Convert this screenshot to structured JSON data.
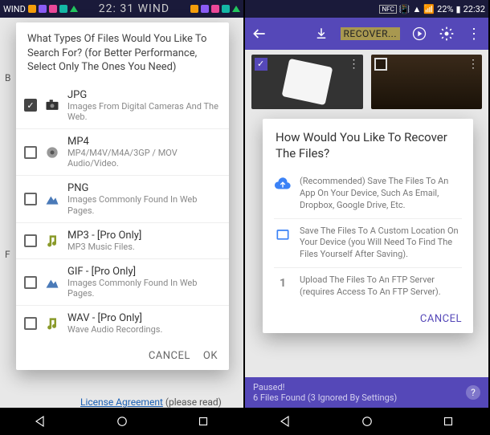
{
  "status": {
    "carrier": "WIND",
    "clock_center": "22: 31 WIND",
    "battery": "22%",
    "time_right": "22:32",
    "nfc": "NFC"
  },
  "left": {
    "dialog_title": "What Types Of Files Would You Like To Search For? (for Better Performance, Select Only The Ones You Need)",
    "files": [
      {
        "name": "JPG",
        "desc": "Images From Digital Cameras And The Web.",
        "checked": true,
        "icon": "camera"
      },
      {
        "name": "MP4",
        "desc": "MP4/M4V/M4A/3GP / MOV Audio/Video.",
        "checked": false,
        "icon": "film"
      },
      {
        "name": "PNG",
        "desc": "Images Commonly Found In Web Pages.",
        "checked": false,
        "icon": "image"
      },
      {
        "name": "MP3 - [Pro Only]",
        "desc": "MP3 Music Files.",
        "checked": false,
        "icon": "music"
      },
      {
        "name": "GIF - [Pro Only]",
        "desc": "Images Commonly Found In Web Pages.",
        "checked": false,
        "icon": "image"
      },
      {
        "name": "WAV - [Pro Only]",
        "desc": "Wave Audio Recordings.",
        "checked": false,
        "icon": "music"
      }
    ],
    "cancel": "CANCEL",
    "ok": "OK",
    "bg_b": "B",
    "bg_f": "F",
    "bg_link": "License Agreement",
    "bg_read": "(please read)"
  },
  "right": {
    "appbar_recover": "RECOVER...",
    "dialog_title": "How Would You Like To Recover The Files?",
    "options": [
      {
        "icon": "cloud",
        "text": "(Recommended) Save The Files To An App On Your Device, Such As Email, Dropbox, Google Drive, Etc."
      },
      {
        "icon": "folder",
        "text": "Save The Files To A Custom Location On Your Device (you Will Need To Find The Files Yourself After Saving)."
      },
      {
        "icon": "ftp",
        "text": "Upload The Files To An FTP Server (requires Access To An FTP Server)."
      }
    ],
    "ftp_num": "1",
    "cancel": "CANCEL",
    "paused_title": "Paused!",
    "paused_sub": "6 Files Found (3 Ignored By Settings)"
  }
}
